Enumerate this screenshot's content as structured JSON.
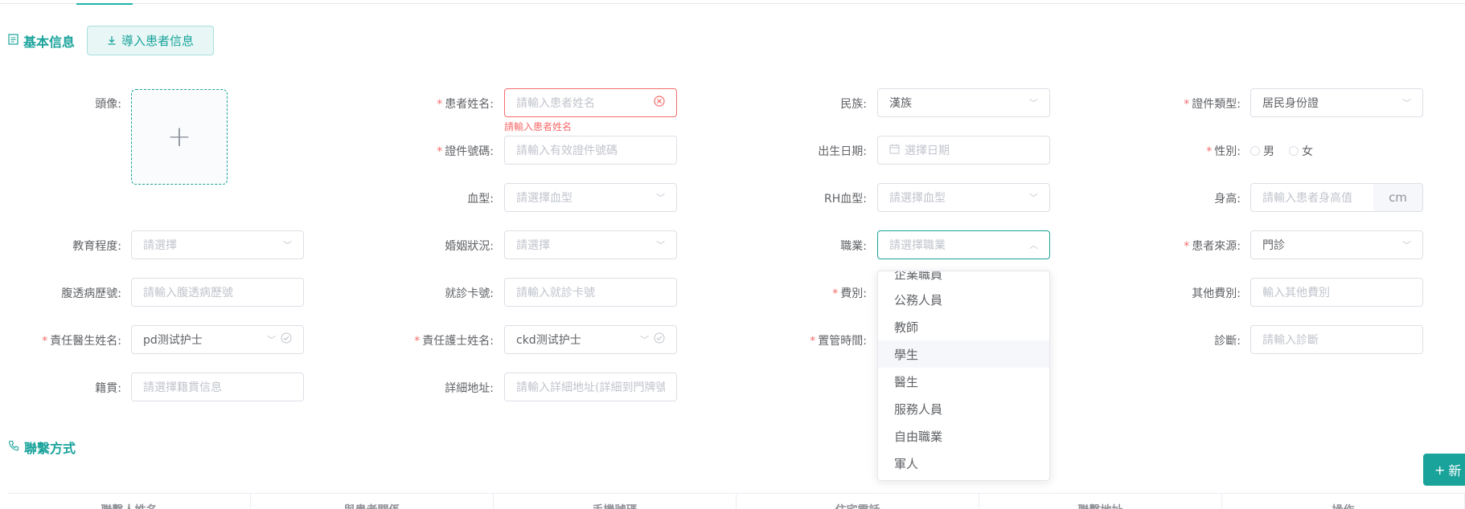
{
  "basic_section": {
    "title": "基本信息",
    "import_label": "導入患者信息"
  },
  "contact_section": {
    "title": "聯繫方式",
    "add_label": "新"
  },
  "fields": {
    "avatar": {
      "label": "頭像:"
    },
    "patient_name": {
      "label": "患者姓名:",
      "placeholder": "請輸入患者姓名",
      "error": "請輸入患者姓名"
    },
    "ethnicity": {
      "label": "民族:",
      "value": "漢族"
    },
    "id_type": {
      "label": "證件類型:",
      "value": "居民身份證"
    },
    "id_number": {
      "label": "證件號碼:",
      "placeholder": "請輸入有效證件號碼"
    },
    "birth_date": {
      "label": "出生日期:",
      "placeholder": "選擇日期"
    },
    "gender": {
      "label": "性別:",
      "options": [
        "男",
        "女"
      ]
    },
    "blood_type": {
      "label": "血型:",
      "placeholder": "請選擇血型"
    },
    "rh_blood": {
      "label": "RH血型:",
      "placeholder": "請選擇血型"
    },
    "height": {
      "label": "身高:",
      "placeholder": "請輸入患者身高值",
      "unit": "cm"
    },
    "education": {
      "label": "教育程度:",
      "placeholder": "請選擇"
    },
    "marital": {
      "label": "婚姻狀況:",
      "placeholder": "請選擇"
    },
    "occupation": {
      "label": "職業:",
      "placeholder": "請選擇職業"
    },
    "patient_source": {
      "label": "患者來源:",
      "value": "門診"
    },
    "dialysis_no": {
      "label": "腹透病歷號:",
      "placeholder": "請輸入腹透病歷號"
    },
    "visit_card": {
      "label": "就診卡號:",
      "placeholder": "請輸入就診卡號"
    },
    "fee_type": {
      "label": "費別:"
    },
    "other_fee": {
      "label": "其他費別:",
      "placeholder": "輸入其他費別"
    },
    "doctor": {
      "label": "責任醫生姓名:",
      "value": "pd测试护士"
    },
    "nurse": {
      "label": "責任護士姓名:",
      "value": "ckd测试护士"
    },
    "catheter_time": {
      "label": "置管時間:"
    },
    "diagnosis": {
      "label": "診斷:",
      "placeholder": "請輸入診斷"
    },
    "native_place": {
      "label": "籍貫:",
      "placeholder": "請選擇籍貫信息"
    },
    "address": {
      "label": "詳細地址:",
      "placeholder": "請輸入詳細地址(詳細到門牌號"
    }
  },
  "occupation_dropdown": {
    "partial_top": "企業職員",
    "items": [
      "公務人員",
      "教師",
      "學生",
      "醫生",
      "服務人員",
      "自由職業",
      "軍人"
    ],
    "hovered": "學生"
  },
  "contact_table": {
    "headers": [
      "聯繫人姓名",
      "與患者關係",
      "手機號碼",
      "住宅電話",
      "聯繫地址",
      "操作"
    ]
  },
  "colors": {
    "accent": "#1aa39b",
    "error": "#f56c6c"
  }
}
